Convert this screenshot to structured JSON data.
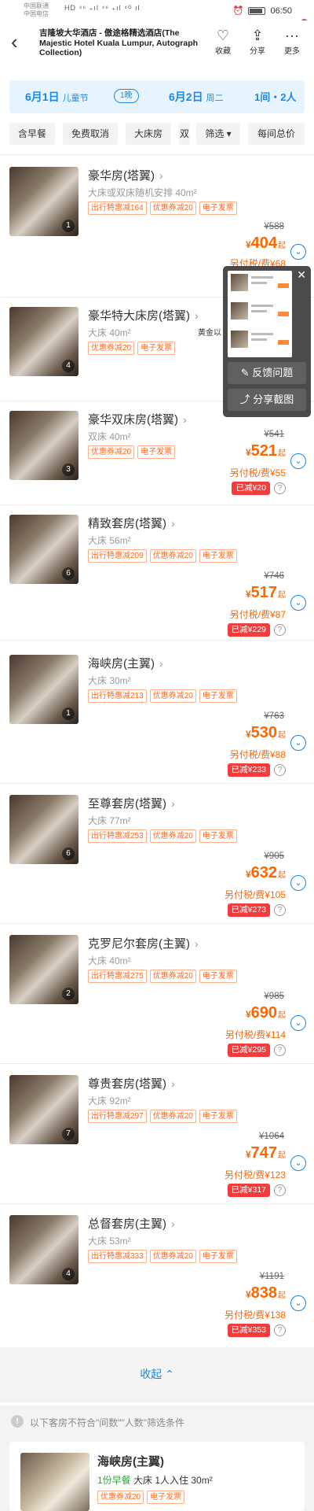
{
  "status_bar": {
    "carrier1": "中国联通",
    "carrier2": "中国电信",
    "signal": "HD ⁴⁶ ₊ıl ⁴⁶ ₊ıl ⁴ᴳ ıl",
    "time": "06:50"
  },
  "header": {
    "back_icon": "back-arrow-icon",
    "title": "吉隆坡大华酒店 - 傲途格精选酒店(The Majestic Hotel Kuala Lumpur, Autograph Collection)",
    "favorite_label": "收藏",
    "share_label": "分享",
    "more_label": "更多"
  },
  "date_bar": {
    "checkin_date": "6月1日",
    "checkin_note": "儿童节",
    "nights": "1晚",
    "checkout_date": "6月2日",
    "checkout_note": "周二",
    "rooms_guests": "1间・2人"
  },
  "filters": {
    "items": [
      "含早餐",
      "免费取消",
      "大床房",
      "双",
      "筛选 ▾",
      "每间总价"
    ]
  },
  "rooms": [
    {
      "name": "豪华房(塔翼)",
      "desc": "大床或双床随机安排 40m²",
      "tags": [
        "出行特惠减164",
        "优惠券减20",
        "电子发票"
      ],
      "original_price": "¥588",
      "price": "404",
      "price_suffix": "起",
      "tax": "另付税/费¥68",
      "saved": "",
      "photo_count": "1"
    },
    {
      "name": "豪华特大床房(塔翼)",
      "desc": "大床 40m²",
      "tags": [
        "优惠券减20",
        "电子发票"
      ],
      "original_price": "",
      "price": "",
      "price_suffix": "",
      "tax": "",
      "saved": "",
      "photo_count": "4",
      "partial_note": "黄金以"
    },
    {
      "name": "豪华双床房(塔翼)",
      "desc": "双床 40m²",
      "tags": [
        "优惠券减20",
        "电子发票"
      ],
      "original_price": "¥541",
      "price": "521",
      "price_suffix": "起",
      "tax": "另付税/费¥55",
      "saved": "已减¥20",
      "photo_count": "3"
    },
    {
      "name": "精致套房(塔翼)",
      "desc": "大床 56m²",
      "tags": [
        "出行特惠减209",
        "优惠券减20",
        "电子发票"
      ],
      "original_price": "¥746",
      "price": "517",
      "price_suffix": "起",
      "tax": "另付税/费¥87",
      "saved": "已减¥229",
      "photo_count": "6"
    },
    {
      "name": "海峡房(主翼)",
      "desc": "大床 30m²",
      "tags": [
        "出行特惠减213",
        "优惠券减20",
        "电子发票"
      ],
      "original_price": "¥763",
      "price": "530",
      "price_suffix": "起",
      "tax": "另付税/费¥88",
      "saved": "已减¥233",
      "photo_count": "1"
    },
    {
      "name": "至尊套房(塔翼)",
      "desc": "大床 77m²",
      "tags": [
        "出行特惠减253",
        "优惠券减20",
        "电子发票"
      ],
      "original_price": "¥905",
      "price": "632",
      "price_suffix": "起",
      "tax": "另付税/费¥105",
      "saved": "已减¥273",
      "photo_count": "6"
    },
    {
      "name": "克罗尼尔套房(主翼)",
      "desc": "大床 40m²",
      "tags": [
        "出行特惠减275",
        "优惠券减20",
        "电子发票"
      ],
      "original_price": "¥985",
      "price": "690",
      "price_suffix": "起",
      "tax": "另付税/费¥114",
      "saved": "已减¥295",
      "photo_count": "2"
    },
    {
      "name": "尊贵套房(塔翼)",
      "desc": "大床 92m²",
      "tags": [
        "出行特惠减297",
        "优惠券减20",
        "电子发票"
      ],
      "original_price": "¥1064",
      "price": "747",
      "price_suffix": "起",
      "tax": "另付税/费¥123",
      "saved": "已减¥317",
      "photo_count": "7"
    },
    {
      "name": "总督套房(主翼)",
      "desc": "大床 53m²",
      "tags": [
        "出行特惠减333",
        "优惠券减20",
        "电子发票"
      ],
      "original_price": "¥1191",
      "price": "838",
      "price_suffix": "起",
      "tax": "另付税/费¥138",
      "saved": "已减¥353",
      "photo_count": "4"
    }
  ],
  "collapse_label": "收起 ⌃",
  "notice_text": "以下客房不符合\"间数\"\"人数\"筛选条件",
  "bottom_room": {
    "name": "海峡房(主翼)",
    "breakfast": "1份早餐",
    "desc": "大床  1人入住  30m²",
    "tags": [
      "优惠券减20",
      "电子发票"
    ]
  },
  "popup": {
    "feedback_label": "反馈问题",
    "share_screenshot_label": "分享截图"
  },
  "colors": {
    "accent_blue": "#1a8ae8",
    "price_orange": "#ff6600",
    "saved_red": "#f53c3c",
    "tag_orange": "#ff6a25"
  }
}
